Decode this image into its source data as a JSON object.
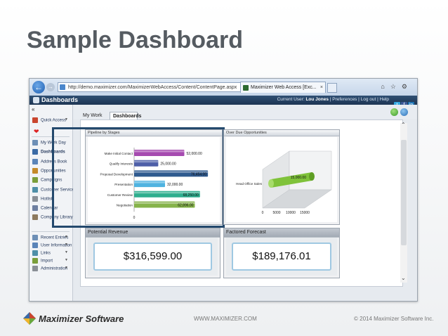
{
  "slide": {
    "title": "Sample Dashboard"
  },
  "browser": {
    "url": "http://demo.maximizer.com/MaximizerWebAccess/Content/ContentPage.aspx",
    "tab_title": "Maximizer Web Access [Exc...",
    "tab_close": "×"
  },
  "app": {
    "title": "Dashboards",
    "current_user_label": "Current User:",
    "current_user": "Lou Jones",
    "links": [
      "Preferences",
      "Log out",
      "Help"
    ],
    "social_icons": [
      "twitter-icon",
      "facebook-icon",
      "linkedin-icon"
    ]
  },
  "sidebar": {
    "collapse": "«",
    "quick_access": "Quick Access",
    "items": [
      {
        "label": "My Work Day",
        "color": "#6d8fb6"
      },
      {
        "label": "Dashboards",
        "color": "#3a6aa5",
        "active": true
      },
      {
        "label": "Address Book",
        "color": "#5a84b8"
      },
      {
        "label": "Opportunities",
        "color": "#c48a2a"
      },
      {
        "label": "Campaigns",
        "color": "#7a9e3a"
      },
      {
        "label": "Customer Service",
        "color": "#4f8fa8"
      },
      {
        "label": "Hotlist",
        "color": "#8a8f96"
      },
      {
        "label": "Calendar",
        "color": "#6d7fa0"
      },
      {
        "label": "Company Library",
        "color": "#8d7a5e"
      }
    ],
    "bottom_items": [
      {
        "label": "Recent Entries",
        "color": "#6d8fb6"
      },
      {
        "label": "User Information",
        "color": "#5a84b8"
      },
      {
        "label": "Links",
        "color": "#4f8fa8"
      },
      {
        "label": "Import",
        "color": "#7a9e3a"
      },
      {
        "label": "Administration",
        "color": "#8a8f96"
      }
    ]
  },
  "dashboard": {
    "tabs": [
      "My Work Day",
      "Dashboards"
    ],
    "active_tab": "Dashboards",
    "panels": {
      "pipeline": "Pipeline by Stages",
      "overdue": "Over Due Opportunities",
      "potential_revenue": "Potential Revenue",
      "factored_forecast": "Factored Forecast"
    },
    "kpis": {
      "potential_revenue": "$316,599.00",
      "factored_forecast": "$189,176.01"
    }
  },
  "chart_data": [
    {
      "type": "bar",
      "orientation": "horizontal",
      "title": "Pipeline by Stages",
      "categories": [
        "Make Initial Contact",
        "Qualify Interests",
        "Proposal Development",
        "Presentation",
        "Customer Review",
        "Negotiation"
      ],
      "values": [
        52000,
        25000,
        76454,
        32000,
        68250,
        62896
      ],
      "labels": [
        "52,000.00",
        "25,000.00",
        "76,454.00",
        "32,000.00",
        "68,250.00",
        "62,896.00"
      ],
      "colors": [
        "#a64bb0",
        "#4e5fa8",
        "#2f5a8f",
        "#4fb3e0",
        "#2eae8e",
        "#86b34a"
      ],
      "xlim": [
        0,
        80000
      ],
      "xticks": [
        "0"
      ]
    },
    {
      "type": "bar",
      "orientation": "horizontal",
      "style": "3d",
      "title": "Over Due Opportunities",
      "categories": [
        "Head Office Sales"
      ],
      "values": [
        15000
      ],
      "labels": [
        "15,000.00"
      ],
      "colors": [
        "#7fc23a"
      ],
      "xlim": [
        0,
        15000
      ],
      "xticks": [
        "0",
        "5000",
        "10000",
        "15000"
      ]
    }
  ],
  "footer": {
    "brand": "Maximizer Software",
    "url": "WWW.MAXIMIZER.COM",
    "copyright": "© 2014 Maximizer Software Inc."
  }
}
